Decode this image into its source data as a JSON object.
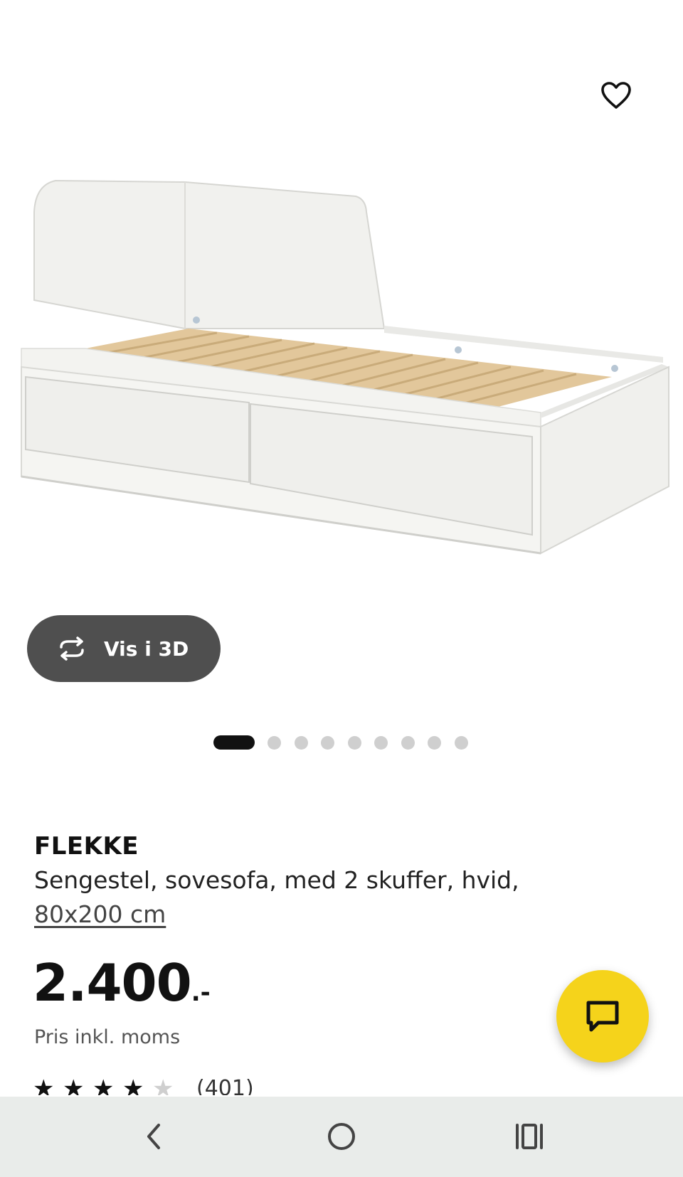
{
  "header": {
    "favorite_icon": "heart-outline-icon"
  },
  "gallery": {
    "view_3d_label": "Vis i 3D",
    "view_3d_icon": "rotate-arrows-icon",
    "slides_count": 9,
    "active_slide": 1
  },
  "product": {
    "name": "FLEKKE",
    "description": "Sengestel, sovesofa, med 2 skuffer, hvid,",
    "size": "80x200 cm",
    "price_main": "2.400",
    "price_suffix": ".-",
    "price_note": "Pris inkl. moms",
    "rating_value": 4.5,
    "rating_max": 5,
    "rating_count": "(401)"
  },
  "chat": {
    "icon": "chat-bubble-icon",
    "color": "#F5D31B"
  },
  "navbar": {
    "back_icon": "back-chevron-icon",
    "home_icon": "home-circle-icon",
    "recents_icon": "recent-apps-icon"
  },
  "colors": {
    "button_dark": "#4F4F4F",
    "accent_yellow": "#F5D31B",
    "navbar_bg": "#E9ECEA"
  }
}
